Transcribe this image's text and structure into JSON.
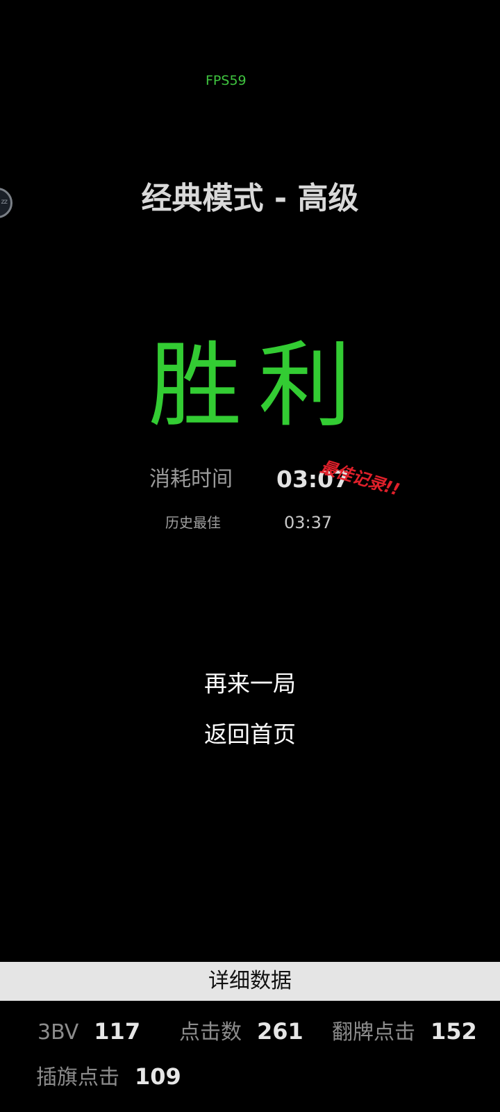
{
  "status": {
    "fps": "FPS59"
  },
  "floating_ball": {
    "label": "zz"
  },
  "game": {
    "mode_title": "经典模式 - 高级",
    "result": "胜利",
    "time_label": "消耗时间",
    "time_value": "03:07",
    "best_record_badge": "最佳记录!!",
    "history_best_label": "历史最佳",
    "history_best_value": "03:37"
  },
  "actions": {
    "play_again": "再来一局",
    "back_home": "返回首页"
  },
  "details": {
    "header": "详细数据",
    "stats": [
      {
        "label": "3BV",
        "value": "117"
      },
      {
        "label": "点击数",
        "value": "261"
      },
      {
        "label": "翻牌点击",
        "value": "152"
      },
      {
        "label": "插旗点击",
        "value": "109"
      }
    ]
  },
  "colors": {
    "background": "#000000",
    "win_green": "#33cc33",
    "fps_green": "#3fc43f",
    "record_red": "#e0202a",
    "details_bar": "#e5e5e5"
  }
}
